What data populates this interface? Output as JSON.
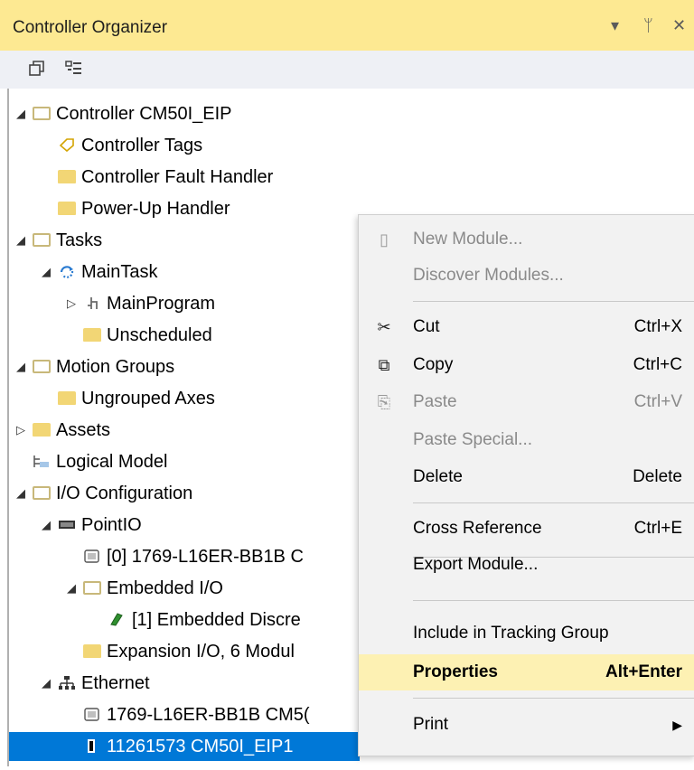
{
  "window": {
    "title": "Controller Organizer",
    "buttons": [
      "▾",
      "ᛘ",
      "✕"
    ]
  },
  "toolbar": {
    "tools": [
      "collapse-all-icon",
      "show-properties-icon"
    ]
  },
  "tree": [
    {
      "label": "Controller CM50I_EIP",
      "icon": "folder-open-icon",
      "exp": "◢"
    },
    {
      "label": "Controller Tags",
      "icon": "tag-icon",
      "exp": ""
    },
    {
      "label": "Controller Fault Handler",
      "icon": "folder-icon",
      "exp": ""
    },
    {
      "label": "Power-Up Handler",
      "icon": "folder-icon",
      "exp": ""
    },
    {
      "label": "Tasks",
      "icon": "folder-open-icon",
      "exp": "◢"
    },
    {
      "label": "MainTask",
      "icon": "task-icon",
      "exp": "◢"
    },
    {
      "label": "MainProgram",
      "icon": "program-icon",
      "exp": "▷"
    },
    {
      "label": "Unscheduled",
      "icon": "folder-icon",
      "exp": ""
    },
    {
      "label": "Motion Groups",
      "icon": "folder-open-icon",
      "exp": "◢"
    },
    {
      "label": "Ungrouped Axes",
      "icon": "folder-icon",
      "exp": ""
    },
    {
      "label": "Assets",
      "icon": "folder-icon",
      "exp": "▷"
    },
    {
      "label": "Logical Model",
      "icon": "logical-model-icon",
      "exp": ""
    },
    {
      "label": "I/O Configuration",
      "icon": "folder-open-icon",
      "exp": "◢"
    },
    {
      "label": "PointIO",
      "icon": "chassis-icon",
      "exp": "◢"
    },
    {
      "label": "[0] 1769-L16ER-BB1B C",
      "icon": "module-icon",
      "exp": ""
    },
    {
      "label": "Embedded I/O",
      "icon": "folder-open-icon",
      "exp": "◢"
    },
    {
      "label": "[1] Embedded Discre",
      "icon": "io-module-icon",
      "exp": ""
    },
    {
      "label": "Expansion I/O, 6 Modul",
      "icon": "folder-icon",
      "exp": ""
    },
    {
      "label": "Ethernet",
      "icon": "network-icon",
      "exp": "◢"
    },
    {
      "label": "1769-L16ER-BB1B CM5(",
      "icon": "module-icon",
      "exp": ""
    },
    {
      "label": "11261573 CM50I_EIP1",
      "icon": "device-icon",
      "exp": ""
    }
  ],
  "context_menu": [
    {
      "label": "New Module...",
      "shortcut": "",
      "icon": "new-module-icon",
      "disabled": true
    },
    {
      "label": "Discover Modules...",
      "shortcut": "",
      "icon": "",
      "disabled": true
    },
    {
      "label": "Cut",
      "shortcut": "Ctrl+X",
      "icon": "cut-icon",
      "disabled": false
    },
    {
      "label": "Copy",
      "shortcut": "Ctrl+C",
      "icon": "copy-icon",
      "disabled": false
    },
    {
      "label": "Paste",
      "shortcut": "Ctrl+V",
      "icon": "paste-icon",
      "disabled": true
    },
    {
      "label": "Paste Special...",
      "shortcut": "",
      "icon": "",
      "disabled": true
    },
    {
      "label": "Delete",
      "shortcut": "Delete",
      "icon": "",
      "disabled": false
    },
    {
      "label": "Cross Reference",
      "shortcut": "Ctrl+E",
      "icon": "",
      "disabled": false
    },
    {
      "label": "Export Module...",
      "shortcut": "",
      "icon": "",
      "disabled": false
    },
    {
      "label": "Include in Tracking Group",
      "shortcut": "",
      "icon": "",
      "disabled": false
    },
    {
      "label": "Properties",
      "shortcut": "Alt+Enter",
      "icon": "",
      "disabled": false,
      "highlighted": true
    },
    {
      "label": "Print",
      "shortcut": "",
      "icon": "",
      "disabled": false,
      "submenu": true
    }
  ],
  "colors": {
    "title_bg": "#fde992",
    "selection": "#0078d7",
    "menu_highlight": "#fdf1b3"
  }
}
